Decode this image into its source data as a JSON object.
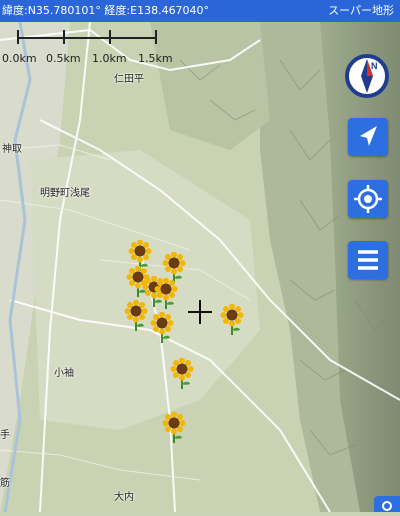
{
  "status_bar": {
    "coordinates": "緯度:N35.780101° 経度:E138.467040°",
    "map_style": "スーパー地形"
  },
  "scale": [
    "0.0km",
    "0.5km",
    "1.0km",
    "1.5km"
  ],
  "place_labels": [
    "仁田平",
    "神取",
    "明野町浅尾",
    "小袖",
    "手",
    "筋",
    "大内"
  ],
  "controls": {
    "compass_letter": "N",
    "accent_color": "#2d6fe0",
    "buttons": [
      "location-arrow-icon",
      "gps-target-icon",
      "menu-icon"
    ]
  },
  "markers": {
    "icon": "sunflower-icon",
    "count": 10
  }
}
